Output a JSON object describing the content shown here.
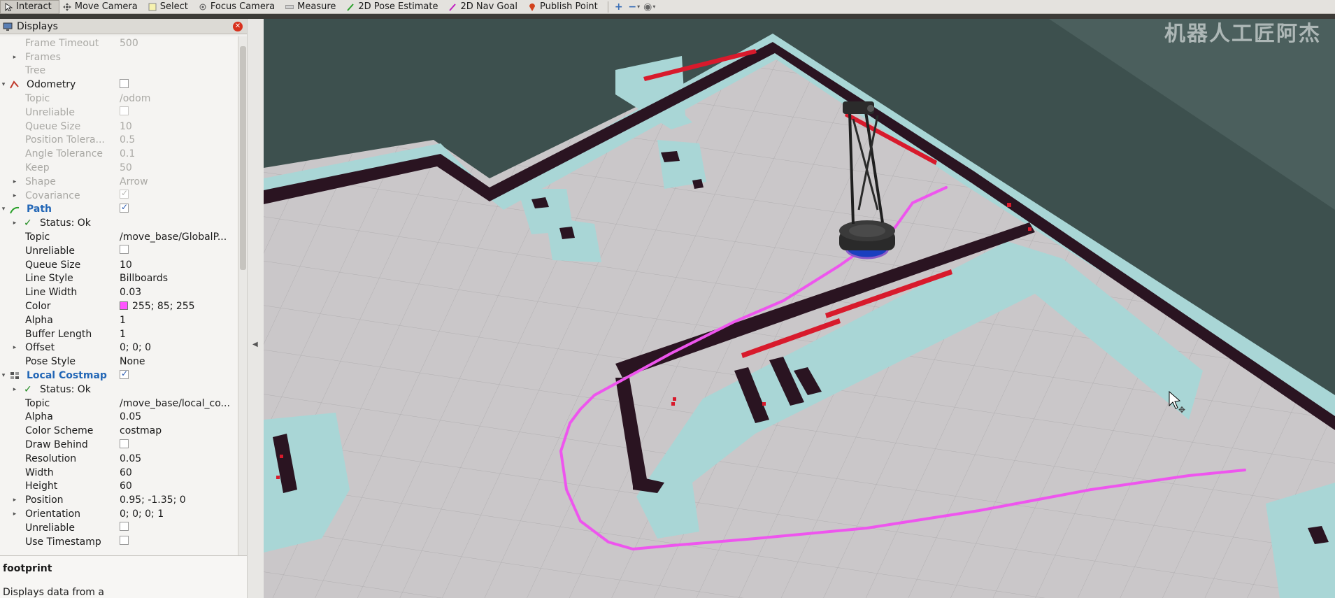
{
  "toolbar": {
    "tools": [
      {
        "label": "Interact",
        "icon": "cursor-icon"
      },
      {
        "label": "Move Camera",
        "icon": "move-camera-icon"
      },
      {
        "label": "Select",
        "icon": "select-icon"
      },
      {
        "label": "Focus Camera",
        "icon": "focus-camera-icon"
      },
      {
        "label": "Measure",
        "icon": "ruler-icon"
      },
      {
        "label": "2D Pose Estimate",
        "icon": "green-arrow-icon"
      },
      {
        "label": "2D Nav Goal",
        "icon": "magenta-arrow-icon"
      },
      {
        "label": "Publish Point",
        "icon": "map-pin-icon"
      }
    ],
    "extra_icons": [
      "plus-icon",
      "minus-icon",
      "eye-icon"
    ]
  },
  "panel": {
    "title": "Displays",
    "rows": [
      {
        "name": "Frame Timeout",
        "value": "500",
        "dim": true,
        "indent": 1
      },
      {
        "name": "Frames",
        "value": "",
        "dim": true,
        "indent": 1,
        "expander": true
      },
      {
        "name": "Tree",
        "value": "",
        "dim": true,
        "indent": 1
      },
      {
        "name": "Odometry",
        "value": "",
        "checkbox": false,
        "indent": 0,
        "expander": "open",
        "icon": "odometry-icon"
      },
      {
        "name": "Topic",
        "value": "/odom",
        "dim": true,
        "indent": 1
      },
      {
        "name": "Unreliable",
        "value": "",
        "checkbox": false,
        "dim": true,
        "indent": 1
      },
      {
        "name": "Queue Size",
        "value": "10",
        "dim": true,
        "indent": 1
      },
      {
        "name": "Position Tolera...",
        "value": "0.5",
        "dim": true,
        "indent": 1
      },
      {
        "name": "Angle Tolerance",
        "value": "0.1",
        "dim": true,
        "indent": 1
      },
      {
        "name": "Keep",
        "value": "50",
        "dim": true,
        "indent": 1
      },
      {
        "name": "Shape",
        "value": "Arrow",
        "dim": true,
        "indent": 1,
        "expander": true
      },
      {
        "name": "Covariance",
        "value": "",
        "checkbox": true,
        "dim": true,
        "indent": 1,
        "expander": true
      },
      {
        "name": "Path",
        "value": "",
        "checkbox": true,
        "indent": 0,
        "expander": "open",
        "blue": true,
        "icon": "path-icon"
      },
      {
        "name": "Status: Ok",
        "value": "",
        "indent": 1,
        "expander": true,
        "status": true
      },
      {
        "name": "Topic",
        "value": "/move_base/GlobalP...",
        "indent": 1
      },
      {
        "name": "Unreliable",
        "value": "",
        "checkbox": false,
        "indent": 1
      },
      {
        "name": "Queue Size",
        "value": "10",
        "indent": 1
      },
      {
        "name": "Line Style",
        "value": "Billboards",
        "indent": 1
      },
      {
        "name": "Line Width",
        "value": "0.03",
        "indent": 1
      },
      {
        "name": "Color",
        "value": "255; 85; 255",
        "swatch": "#ff55ff",
        "indent": 1
      },
      {
        "name": "Alpha",
        "value": "1",
        "indent": 1
      },
      {
        "name": "Buffer Length",
        "value": "1",
        "indent": 1
      },
      {
        "name": "Offset",
        "value": "0; 0; 0",
        "indent": 1,
        "expander": true
      },
      {
        "name": "Pose Style",
        "value": "None",
        "indent": 1
      },
      {
        "name": "Local Costmap",
        "value": "",
        "checkbox": true,
        "indent": 0,
        "expander": "open",
        "blue": true,
        "icon": "grid-icon"
      },
      {
        "name": "Status: Ok",
        "value": "",
        "indent": 1,
        "expander": true,
        "status": true
      },
      {
        "name": "Topic",
        "value": "/move_base/local_co...",
        "indent": 1
      },
      {
        "name": "Alpha",
        "value": "0.05",
        "indent": 1
      },
      {
        "name": "Color Scheme",
        "value": "costmap",
        "indent": 1
      },
      {
        "name": "Draw Behind",
        "value": "",
        "checkbox": false,
        "indent": 1
      },
      {
        "name": "Resolution",
        "value": "0.05",
        "indent": 1
      },
      {
        "name": "Width",
        "value": "60",
        "indent": 1
      },
      {
        "name": "Height",
        "value": "60",
        "indent": 1
      },
      {
        "name": "Position",
        "value": "0.95; -1.35; 0",
        "indent": 1,
        "expander": true
      },
      {
        "name": "Orientation",
        "value": "0; 0; 0; 1",
        "indent": 1,
        "expander": true
      },
      {
        "name": "Unreliable",
        "value": "",
        "checkbox": false,
        "indent": 1
      },
      {
        "name": "Use Timestamp",
        "value": "",
        "checkbox": false,
        "indent": 1
      }
    ],
    "description_title": "footprint",
    "description_text": "Displays data from a"
  },
  "watermark": "机器人工匠阿杰",
  "colors": {
    "path": "#ee55ee",
    "floor": "#c9c6c8",
    "inflation": "#a9d8d8",
    "obstacle": "#2b1522",
    "background": "#3b4f4d"
  }
}
